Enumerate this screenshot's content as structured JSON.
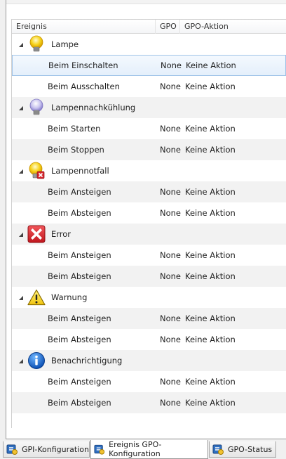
{
  "columns": {
    "event": "Ereignis",
    "gpo": "GPO",
    "action": "GPO-Aktion"
  },
  "groups": [
    {
      "title": "Lampe",
      "icon": "lamp-on-icon",
      "toggle": "◢",
      "items": [
        {
          "name": "Beim Einschalten",
          "gpo": "None",
          "action": "Keine Aktion"
        },
        {
          "name": "Beim Ausschalten",
          "gpo": "None",
          "action": "Keine Aktion"
        }
      ]
    },
    {
      "title": "Lampennachkühlung",
      "icon": "lamp-cooldown-icon",
      "toggle": "◢",
      "items": [
        {
          "name": "Beim Starten",
          "gpo": "None",
          "action": "Keine Aktion"
        },
        {
          "name": "Beim Stoppen",
          "gpo": "None",
          "action": "Keine Aktion"
        }
      ]
    },
    {
      "title": "Lampennotfall",
      "icon": "lamp-emergency-icon",
      "toggle": "◢",
      "items": [
        {
          "name": "Beim Ansteigen",
          "gpo": "None",
          "action": "Keine Aktion"
        },
        {
          "name": "Beim Absteigen",
          "gpo": "None",
          "action": "Keine Aktion"
        }
      ]
    },
    {
      "title": "Error",
      "icon": "error-icon",
      "toggle": "◢",
      "items": [
        {
          "name": "Beim Ansteigen",
          "gpo": "None",
          "action": "Keine Aktion"
        },
        {
          "name": "Beim Absteigen",
          "gpo": "None",
          "action": "Keine Aktion"
        }
      ]
    },
    {
      "title": "Warnung",
      "icon": "warning-icon",
      "toggle": "◢",
      "items": [
        {
          "name": "Beim Ansteigen",
          "gpo": "None",
          "action": "Keine Aktion"
        },
        {
          "name": "Beim Absteigen",
          "gpo": "None",
          "action": "Keine Aktion"
        }
      ]
    },
    {
      "title": "Benachrichtigung",
      "icon": "info-icon",
      "toggle": "◢",
      "items": [
        {
          "name": "Beim Ansteigen",
          "gpo": "None",
          "action": "Keine Aktion"
        },
        {
          "name": "Beim Absteigen",
          "gpo": "None",
          "action": "Keine Aktion"
        }
      ]
    }
  ],
  "tabs": [
    {
      "label": "GPI-Konfiguration",
      "icon": "gpi-config-icon",
      "active": false
    },
    {
      "label": "Ereignis GPO-Konfiguration",
      "icon": "event-gpo-config-icon",
      "active": true
    },
    {
      "label": "GPO-Status",
      "icon": "gpo-status-icon",
      "active": false
    }
  ],
  "colors": {
    "selection": "#e4effb",
    "selection_border": "#9fc3e8",
    "row_alt": "#f2f2f2"
  }
}
